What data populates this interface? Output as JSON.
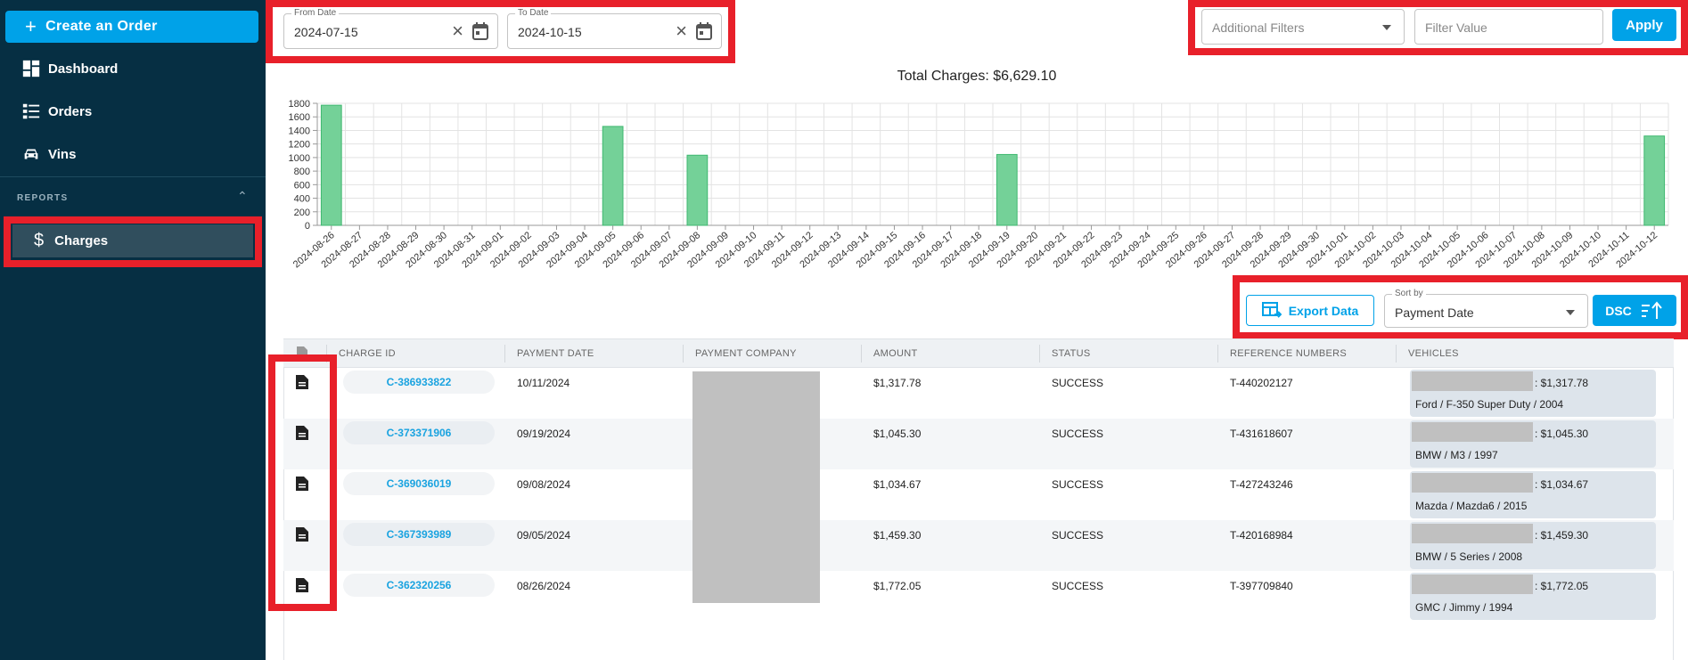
{
  "sidebar": {
    "create_label": "Create an Order",
    "nav": [
      {
        "label": "Dashboard",
        "icon": "dashboard-icon"
      },
      {
        "label": "Orders",
        "icon": "orders-list-icon"
      },
      {
        "label": "Vins",
        "icon": "car-icon"
      }
    ],
    "reports_heading": "REPORTS",
    "charges_label": "Charges"
  },
  "filters": {
    "from_date_label": "From Date",
    "from_date_value": "2024-07-15",
    "to_date_label": "To Date",
    "to_date_value": "2024-10-15",
    "additional_filters_placeholder": "Additional Filters",
    "filter_value_placeholder": "Filter Value",
    "apply_label": "Apply"
  },
  "chart_data": {
    "type": "bar",
    "title": "Total Charges: $6,629.10",
    "categories": [
      "2024-08-26",
      "2024-08-27",
      "2024-08-28",
      "2024-08-29",
      "2024-08-30",
      "2024-08-31",
      "2024-09-01",
      "2024-09-02",
      "2024-09-03",
      "2024-09-04",
      "2024-09-05",
      "2024-09-06",
      "2024-09-07",
      "2024-09-08",
      "2024-09-09",
      "2024-09-10",
      "2024-09-11",
      "2024-09-12",
      "2024-09-13",
      "2024-09-14",
      "2024-09-15",
      "2024-09-16",
      "2024-09-17",
      "2024-09-18",
      "2024-09-19",
      "2024-09-20",
      "2024-09-21",
      "2024-09-22",
      "2024-09-23",
      "2024-09-24",
      "2024-09-25",
      "2024-09-26",
      "2024-09-27",
      "2024-09-28",
      "2024-09-29",
      "2024-09-30",
      "2024-10-01",
      "2024-10-02",
      "2024-10-03",
      "2024-10-04",
      "2024-10-05",
      "2024-10-06",
      "2024-10-07",
      "2024-10-08",
      "2024-10-09",
      "2024-10-10",
      "2024-10-11",
      "2024-10-12"
    ],
    "values": [
      1772.05,
      0,
      0,
      0,
      0,
      0,
      0,
      0,
      0,
      0,
      1459.3,
      0,
      0,
      1034.67,
      0,
      0,
      0,
      0,
      0,
      0,
      0,
      0,
      0,
      0,
      1045.3,
      0,
      0,
      0,
      0,
      0,
      0,
      0,
      0,
      0,
      0,
      0,
      0,
      0,
      0,
      0,
      0,
      0,
      0,
      0,
      0,
      0,
      0,
      1317.78
    ],
    "yticks": [
      0,
      200,
      400,
      600,
      800,
      1000,
      1200,
      1400,
      1600,
      1800
    ],
    "ylim": [
      0,
      1800
    ],
    "grid": true,
    "bar_color": "#74d198",
    "bar_edge_color": "#3fb870"
  },
  "sort": {
    "export_label": "Export Data",
    "sort_by_label": "Sort by",
    "sort_by_value": "Payment Date",
    "order_label": "DSC"
  },
  "table": {
    "columns": [
      "CHARGE ID",
      "PAYMENT DATE",
      "PAYMENT COMPANY",
      "AMOUNT",
      "STATUS",
      "REFERENCE NUMBERS",
      "VEHICLES"
    ],
    "rows": [
      {
        "charge_id": "C-386933822",
        "payment_date": "10/11/2024",
        "amount": "$1,317.78",
        "status": "SUCCESS",
        "reference": "T-440202127",
        "vehicle_amount": ": $1,317.78",
        "vehicle_name": "Ford / F-350 Super Duty / 2004"
      },
      {
        "charge_id": "C-373371906",
        "payment_date": "09/19/2024",
        "amount": "$1,045.30",
        "status": "SUCCESS",
        "reference": "T-431618607",
        "vehicle_amount": ": $1,045.30",
        "vehicle_name": "BMW / M3 / 1997"
      },
      {
        "charge_id": "C-369036019",
        "payment_date": "09/08/2024",
        "amount": "$1,034.67",
        "status": "SUCCESS",
        "reference": "T-427243246",
        "vehicle_amount": ": $1,034.67",
        "vehicle_name": "Mazda / Mazda6 / 2015"
      },
      {
        "charge_id": "C-367393989",
        "payment_date": "09/05/2024",
        "amount": "$1,459.30",
        "status": "SUCCESS",
        "reference": "T-420168984",
        "vehicle_amount": ": $1,459.30",
        "vehicle_name": "BMW / 5 Series / 2008"
      },
      {
        "charge_id": "C-362320256",
        "payment_date": "08/26/2024",
        "amount": "$1,772.05",
        "status": "SUCCESS",
        "reference": "T-397709840",
        "vehicle_amount": ": $1,772.05",
        "vehicle_name": "GMC / Jimmy / 1994"
      }
    ]
  },
  "colors": {
    "accent": "#00a2e8",
    "sidebar_bg": "#062f43",
    "highlight": "#e8202a"
  }
}
